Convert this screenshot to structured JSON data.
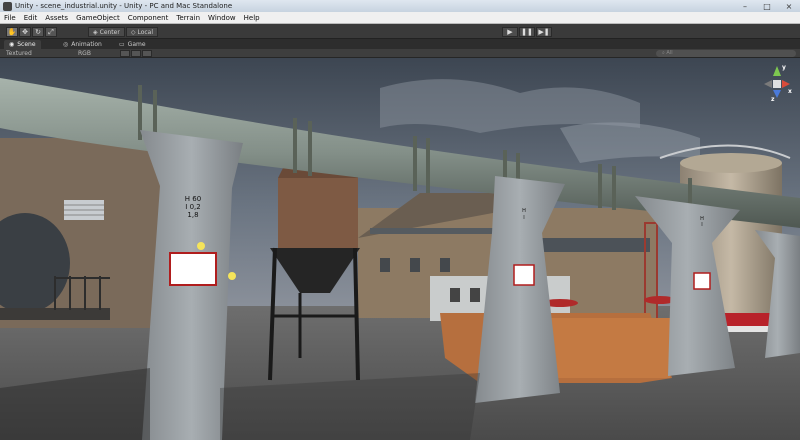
{
  "window": {
    "title": "Unity - scene_industrial.unity - Unity - PC and Mac Standalone",
    "minimize_symbol": "–",
    "maximize_symbol": "□",
    "close_symbol": "×"
  },
  "menu": {
    "items": [
      "File",
      "Edit",
      "Assets",
      "GameObject",
      "Component",
      "Terrain",
      "Window",
      "Help"
    ]
  },
  "toolbar": {
    "tools": [
      {
        "icon": "hand-icon",
        "glyph": "✋"
      },
      {
        "icon": "move-icon",
        "glyph": "✥"
      },
      {
        "icon": "rotate-icon",
        "glyph": "↻"
      },
      {
        "icon": "scale-icon",
        "glyph": "⤢"
      }
    ],
    "pivot_label": "Center",
    "space_label": "Local",
    "play_glyph": "▶",
    "pause_glyph": "❚❚",
    "step_glyph": "▶❚"
  },
  "tabs": [
    {
      "label": "Scene",
      "icon": "scene-tab-icon",
      "glyph": "◉",
      "active": true
    },
    {
      "label": "Animation",
      "icon": "animation-tab-icon",
      "glyph": "◎",
      "active": false
    },
    {
      "label": "Game",
      "icon": "game-tab-icon",
      "glyph": "▭",
      "active": false
    }
  ],
  "scene_toolbar": {
    "render_mode": "Textured",
    "color_mode": "RGB",
    "search_placeholder": "All"
  },
  "scene": {
    "signs": [
      {
        "lines": [
          "H 60",
          "I 0,2",
          "1,8"
        ]
      },
      {
        "lines": [
          "H",
          "I"
        ]
      },
      {
        "lines": [
          "H",
          "I"
        ]
      }
    ],
    "gizmo": {
      "x_label": "x",
      "y_label": "y",
      "z_label": "z"
    },
    "colors": {
      "sky": "#5a6472",
      "pipe": "#8e9a92",
      "concrete": "#9aa0a4",
      "ground": "#5a5a5a"
    }
  }
}
